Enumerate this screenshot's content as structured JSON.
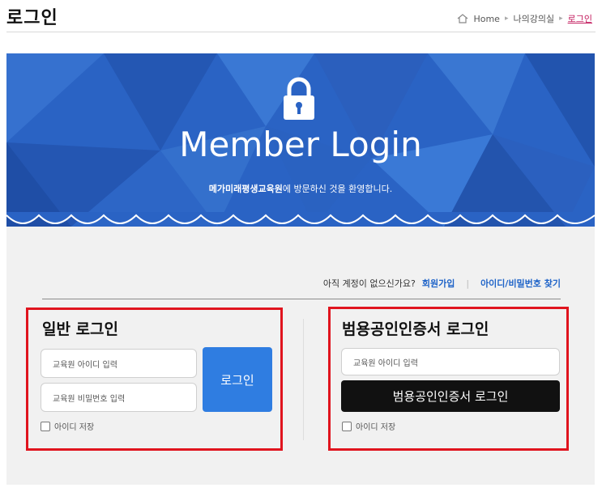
{
  "header": {
    "title": "로그인",
    "breadcrumb": [
      "Home",
      "나의강의실",
      "로그인"
    ],
    "separator": "▸"
  },
  "banner": {
    "title": "Member Login",
    "subtitle_bold": "메가미래평생교육원",
    "subtitle_rest": "에 방문하신 것을 환영합니다."
  },
  "links": {
    "question": "아직 계정이 없으신가요?",
    "signup": "회원가입",
    "divider": "|",
    "find": "아이디/비밀번호 찾기"
  },
  "general_login": {
    "title": "일반 로그인",
    "id_placeholder": "교육원 아이디 입력",
    "pw_placeholder": "교육원 비밀번호 입력",
    "button": "로그인",
    "save_id": "아이디 저장"
  },
  "cert_login": {
    "title": "범용공인인증서 로그인",
    "id_placeholder": "교육원 아이디 입력",
    "button": "범용공인인증서 로그인",
    "save_id": "아이디 저장"
  },
  "colors": {
    "banner_blue": "#2a63c4",
    "login_button": "#2f7de1",
    "highlight_red": "#e0141e",
    "link_blue": "#1e63c8",
    "breadcrumb_current": "#c2185b"
  }
}
